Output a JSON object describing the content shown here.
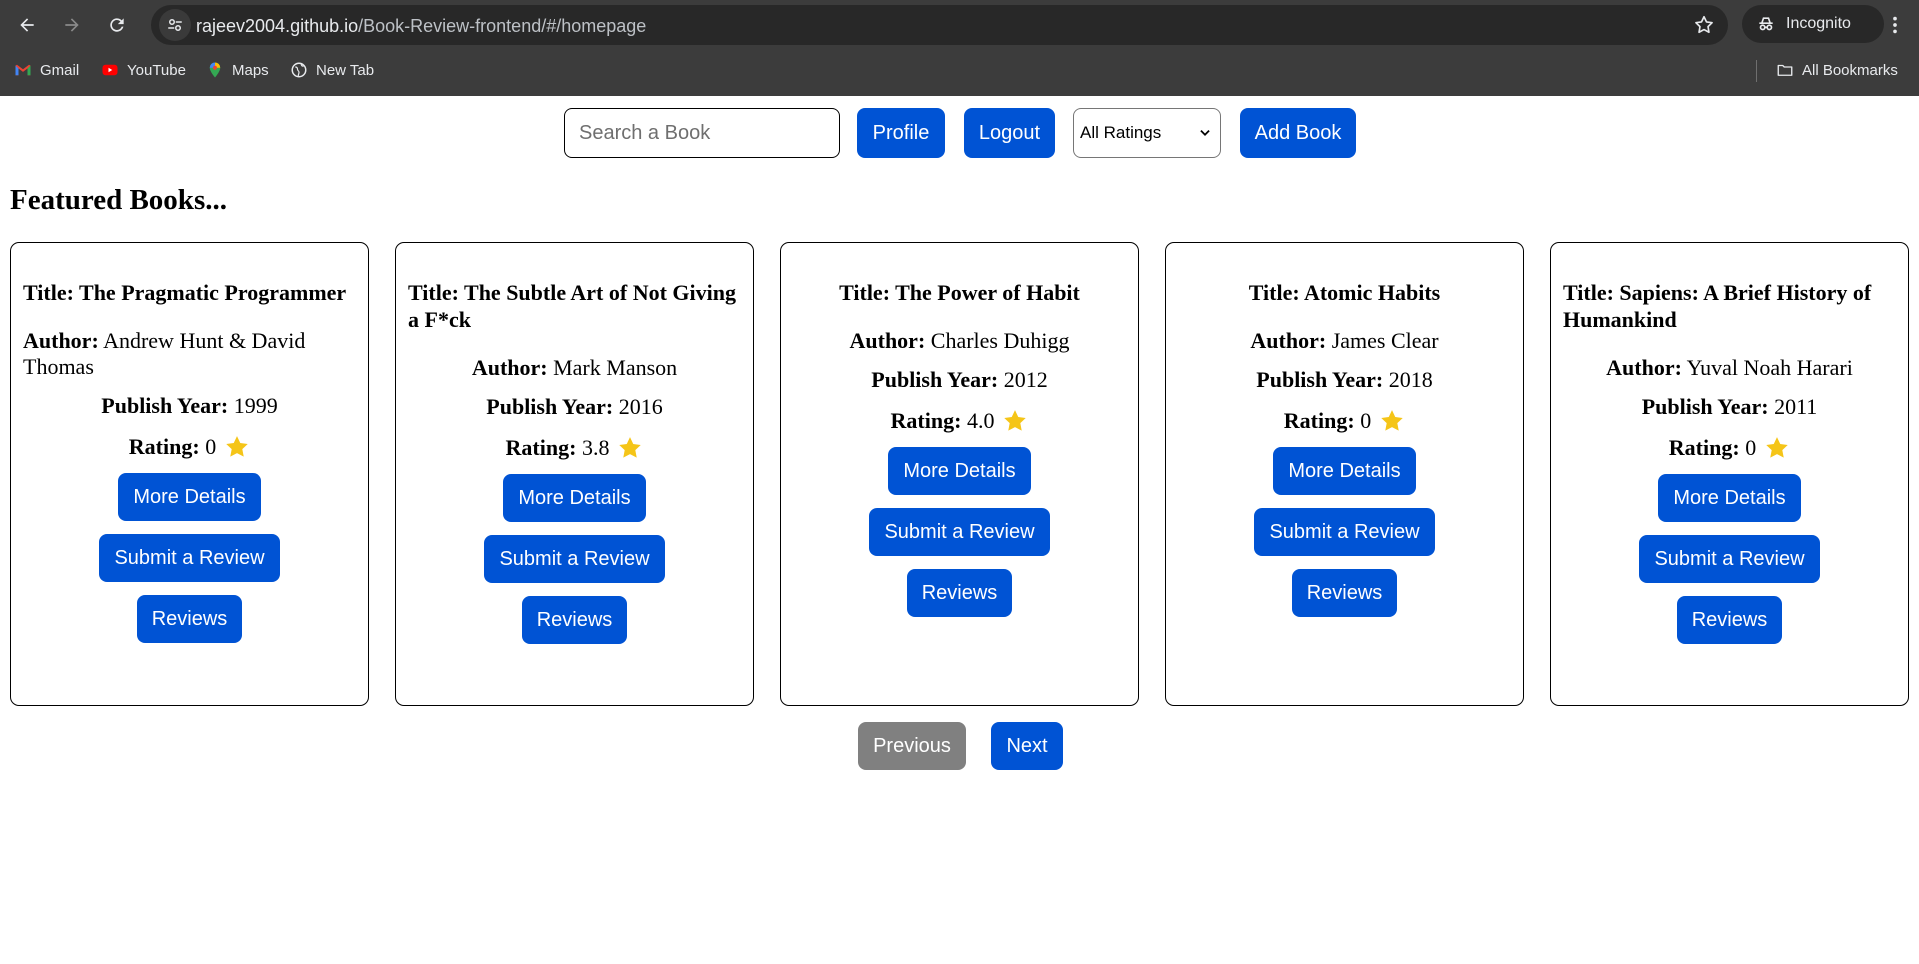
{
  "browser": {
    "url_host": "rajeev2004.github.io",
    "url_path": "/Book-Review-frontend/#/homepage",
    "incognito_label": "Incognito",
    "bookmarks": [
      {
        "label": "Gmail",
        "icon": "gmail-icon"
      },
      {
        "label": "YouTube",
        "icon": "youtube-icon"
      },
      {
        "label": "Maps",
        "icon": "maps-icon"
      },
      {
        "label": "New Tab",
        "icon": "globe-icon"
      }
    ],
    "all_bookmarks_label": "All Bookmarks"
  },
  "header": {
    "search_placeholder": "Search a Book",
    "profile_label": "Profile",
    "logout_label": "Logout",
    "ratings_selected": "All Ratings",
    "add_book_label": "Add Book"
  },
  "section_title": "Featured Books...",
  "labels": {
    "author": "Author:",
    "publish_year": "Publish Year:",
    "rating": "Rating:",
    "more_details": "More Details",
    "submit_review": "Submit a Review",
    "reviews": "Reviews"
  },
  "books": [
    {
      "title": "Title: The Pragmatic Programmer",
      "author": "Andrew Hunt & David Thomas",
      "year": "1999",
      "rating": "0"
    },
    {
      "title": "Title: The Subtle Art of Not Giving a F*ck",
      "author": "Mark Manson",
      "year": "2016",
      "rating": "3.8"
    },
    {
      "title": "Title: The Power of Habit",
      "author": "Charles Duhigg",
      "year": "2012",
      "rating": "4.0"
    },
    {
      "title": "Title: Atomic Habits",
      "author": "James Clear",
      "year": "2018",
      "rating": "0"
    },
    {
      "title": "Title: Sapiens: A Brief History of Humankind",
      "author": "Yuval Noah Harari",
      "year": "2011",
      "rating": "0"
    }
  ],
  "pagination": {
    "previous_label": "Previous",
    "next_label": "Next"
  },
  "colors": {
    "primary_button": "#0053d4",
    "disabled_button": "#808080",
    "star": "#f5c518"
  }
}
